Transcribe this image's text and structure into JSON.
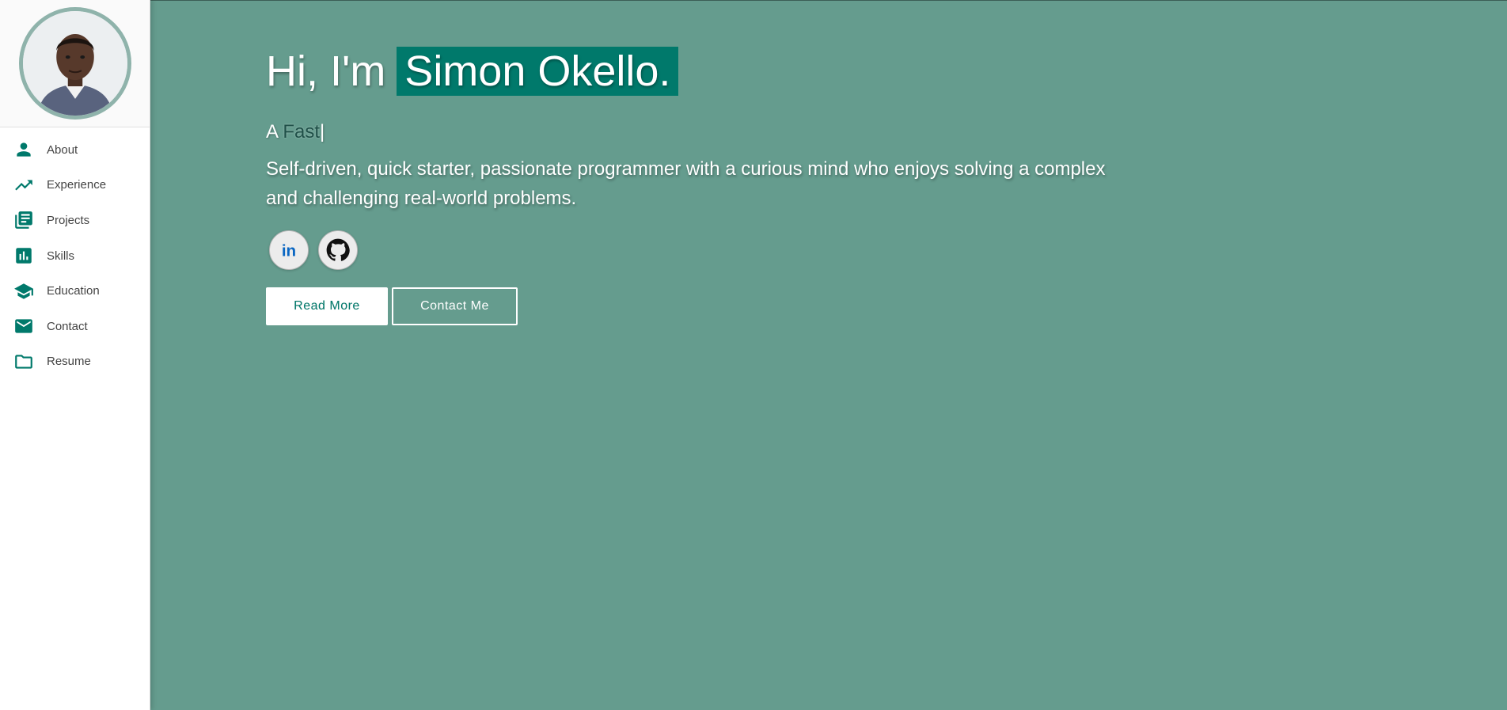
{
  "sidebar": {
    "avatar_alt": "Profile photo",
    "items": [
      {
        "label": "About",
        "icon": "person-icon"
      },
      {
        "label": "Experience",
        "icon": "trending-up-icon"
      },
      {
        "label": "Projects",
        "icon": "library-books-icon"
      },
      {
        "label": "Skills",
        "icon": "bar-chart-icon"
      },
      {
        "label": "Education",
        "icon": "school-icon"
      },
      {
        "label": "Contact",
        "icon": "mail-icon"
      },
      {
        "label": "Resume",
        "icon": "folder-icon"
      }
    ]
  },
  "hero": {
    "greeting": "Hi, I'm",
    "name": "Simon Okello.",
    "typed_prefix": "A",
    "typed_word": "Fast",
    "cursor": "|",
    "description": "Self-driven, quick starter, passionate programmer with a curious mind who enjoys solving a complex and challenging real-world problems."
  },
  "socials": [
    {
      "name": "LinkedIn",
      "icon": "linkedin-icon",
      "label": "in"
    },
    {
      "name": "GitHub",
      "icon": "github-icon"
    }
  ],
  "buttons": {
    "read_more": "Read More",
    "contact": "Contact Me"
  },
  "colors": {
    "accent": "#00796b",
    "background": "#659c8e",
    "sidebar": "#ffffff",
    "avatar_ring": "#8fb3ab"
  }
}
